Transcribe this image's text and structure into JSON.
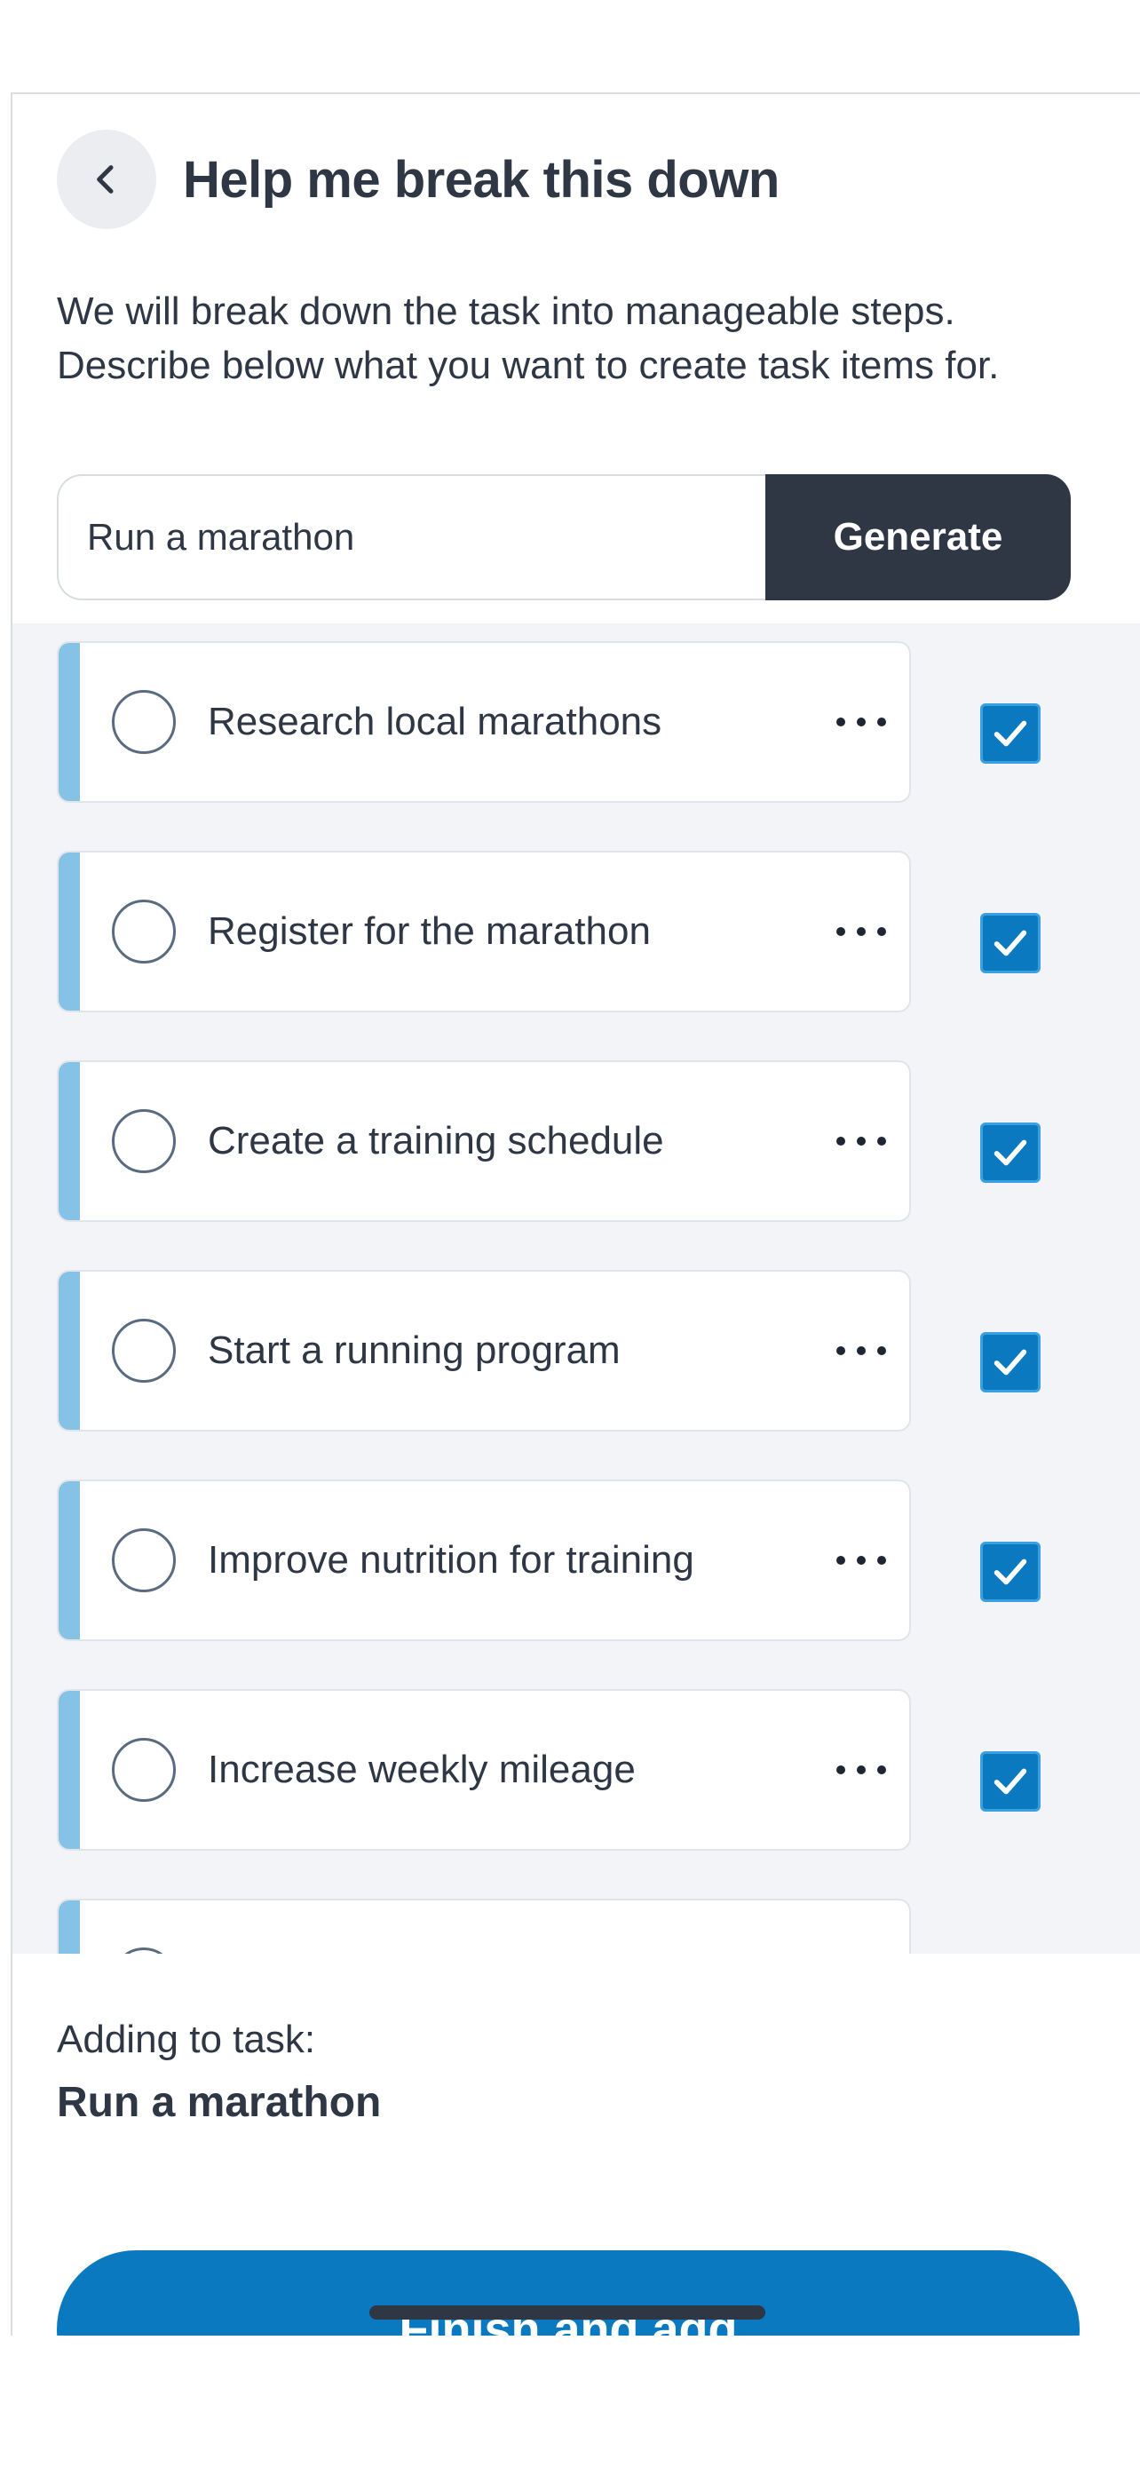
{
  "header": {
    "title": "Help me break this down"
  },
  "description": "We will break down the task into manageable steps. Describe below what you want to create task items for.",
  "input": {
    "value": "Run a marathon",
    "generate_label": "Generate"
  },
  "items": [
    {
      "label": "Research local marathons",
      "checked": true
    },
    {
      "label": "Register for the marathon",
      "checked": true
    },
    {
      "label": "Create a training schedule",
      "checked": true
    },
    {
      "label": "Start a running program",
      "checked": true
    },
    {
      "label": "Improve nutrition for training",
      "checked": true
    },
    {
      "label": "Increase weekly mileage",
      "checked": true
    },
    {
      "label": "",
      "checked": false
    }
  ],
  "footer": {
    "adding_label": "Adding to task:",
    "adding_value": "Run a marathon",
    "finish_label": "Finish and add"
  },
  "colors": {
    "primary": "#0A79BF",
    "dark": "#2F3644",
    "accent": "#86C2E6",
    "list_bg": "#F3F4F7"
  }
}
